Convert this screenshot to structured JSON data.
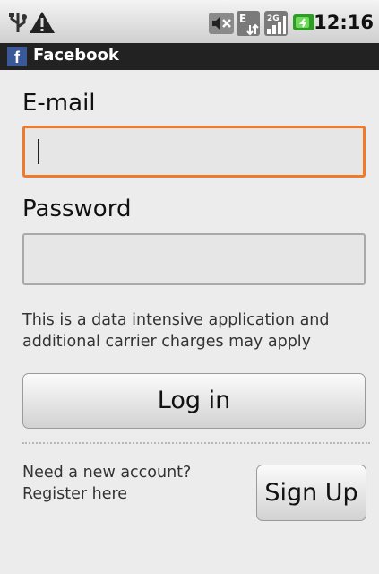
{
  "status_bar": {
    "time": "12:16",
    "icons": [
      "usb-icon",
      "warning-icon",
      "mute-icon",
      "edge-data-icon",
      "signal-2g-icon",
      "battery-icon"
    ]
  },
  "title_bar": {
    "logo": "f",
    "title": "Facebook"
  },
  "form": {
    "email_label": "E-mail",
    "email_value": "",
    "password_label": "Password",
    "password_value": "",
    "notice_line1": "This is a data intensive application and",
    "notice_line2": "additional carrier charges may apply",
    "login_label": "Log in"
  },
  "register": {
    "line1": "Need a new account?",
    "line2": "Register here",
    "signup_label": "Sign Up"
  },
  "colors": {
    "focus_border": "#f07a2a",
    "facebook_blue": "#3b5998"
  }
}
